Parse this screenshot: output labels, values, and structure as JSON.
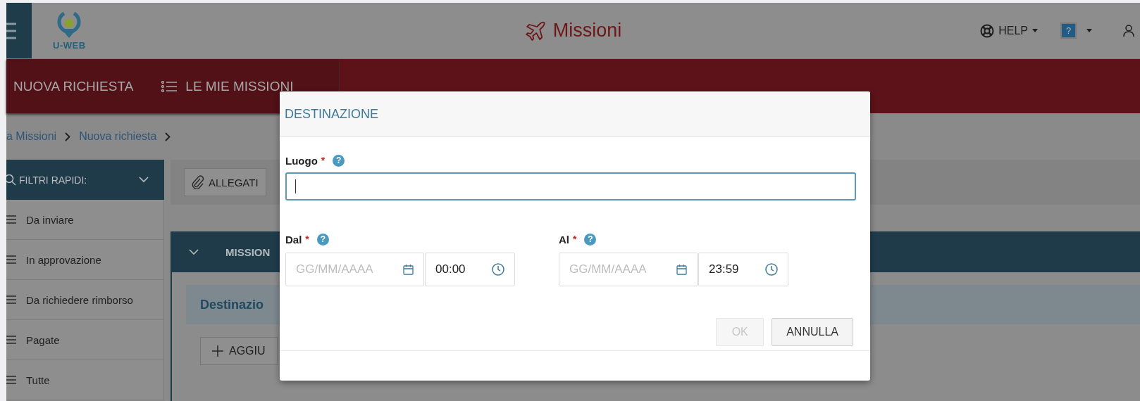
{
  "app": {
    "logo": "U-WEB",
    "title": "Missioni"
  },
  "header_actions": {
    "help": "HELP",
    "manual": "?"
  },
  "nav": [
    {
      "label": "NUOVA RICHIESTA",
      "kind": "plain"
    },
    {
      "label": "LE MIE MISSIONI",
      "kind": "list"
    }
  ],
  "breadcrumb": [
    "a Missioni",
    "Nuova richiesta"
  ],
  "sidebar": {
    "title": "FILTRI RAPIDI:",
    "items": [
      "Da inviare",
      "In approvazione",
      "Da richiedere rimborso",
      "Pagate",
      "Tutte"
    ]
  },
  "toolbar": {
    "buttons": [
      "ALLEGATI"
    ]
  },
  "panel": {
    "title": "MISSION",
    "section": "Destinazio",
    "add_button": "AGGIU"
  },
  "dialog": {
    "title": "DESTINAZIONE",
    "place": {
      "label": "Luogo",
      "required_mark": "*",
      "hint": "?"
    },
    "ranges": [
      {
        "label": "Dal",
        "required_mark": "*",
        "hint": "?",
        "date_placeholder": "GG/MM/AAAA",
        "time": "00:00"
      },
      {
        "label": "Al",
        "required_mark": "*",
        "hint": "?",
        "date_placeholder": "GG/MM/AAAA",
        "time": "23:59"
      }
    ],
    "buttons": [
      {
        "label": "OK",
        "disabled": true
      },
      {
        "label": "ANNULLA",
        "disabled": false
      }
    ]
  }
}
